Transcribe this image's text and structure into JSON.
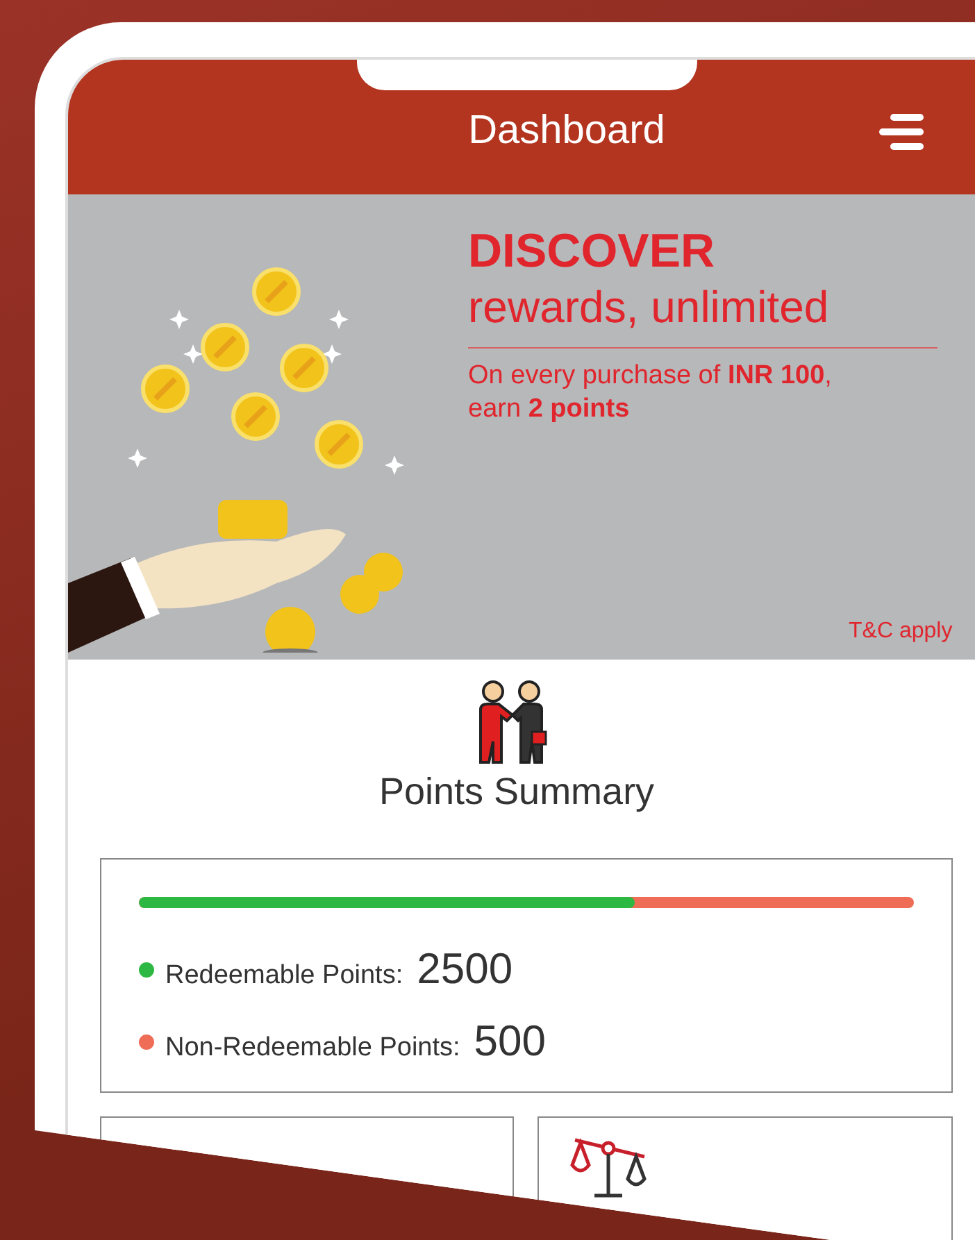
{
  "header": {
    "title": "Dashboard"
  },
  "banner": {
    "headline": "DISCOVER",
    "subheadline": "rewards, unlimited",
    "offer": "On every purchase of **INR 100**, earn **2 points**",
    "terms": "T&C apply"
  },
  "points_summary": {
    "title": "Points Summary",
    "level": 0.64,
    "items": [
      {
        "label": "Redeemable Points:",
        "value": "2500",
        "color": "#2db843"
      },
      {
        "label": "Non-Redeemable Points:",
        "value": "500",
        "color": "#ef6c57"
      }
    ]
  }
}
